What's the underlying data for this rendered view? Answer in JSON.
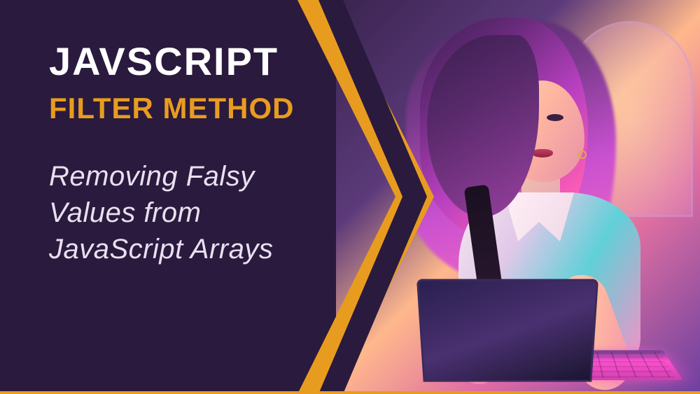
{
  "heading": {
    "main": "JAVSCRIPT",
    "sub": "FILTER METHOD"
  },
  "description": "Removing Falsy Values from JavaScript Arrays",
  "colors": {
    "background": "#2a1a3e",
    "accent": "#e89c1f",
    "text_primary": "#ffffff",
    "text_secondary": "#e8e0f0"
  },
  "illustration": {
    "subject": "woman-typing-on-laptop",
    "style": "digital-art-neon"
  }
}
